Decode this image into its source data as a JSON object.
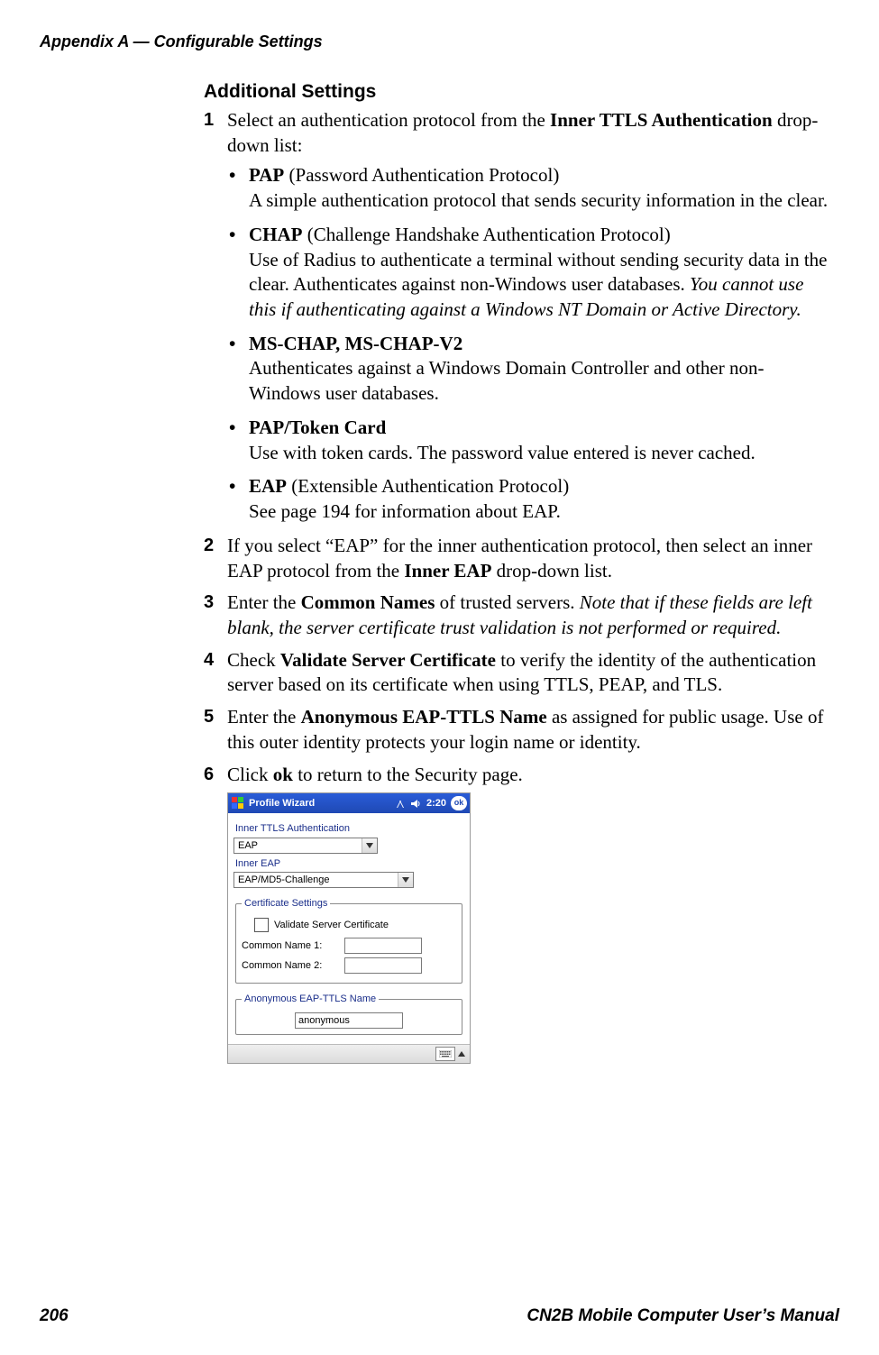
{
  "runningHeader": "Appendix A — Configurable Settings",
  "sectionTitle": "Additional Settings",
  "steps": {
    "s1_a": "Select an authentication protocol from the ",
    "s1_b": "Inner TTLS Authentication",
    "s1_c": " drop-down list:",
    "s2_a": "If you select “EAP” for the inner authentication protocol, then select an inner EAP protocol from the ",
    "s2_b": "Inner EAP",
    "s2_c": " drop-down list.",
    "s3_a": "Enter the ",
    "s3_b": "Common Names",
    "s3_c": " of trusted servers. ",
    "s3_d": "Note that if these fields are left blank, the server certificate trust validation is not performed or required.",
    "s4_a": "Check ",
    "s4_b": "Validate Server Certificate",
    "s4_c": " to verify the identity of the authentication server based on its certificate when using TTLS, PEAP, and TLS.",
    "s5_a": "Enter the ",
    "s5_b": "Anonymous EAP-TTLS Name",
    "s5_c": " as assigned for public usage. Use of this outer identity protects your login name or identity.",
    "s6_a": "Click ",
    "s6_b": "ok",
    "s6_c": " to return to the Security page."
  },
  "bullets": {
    "pap_title": "PAP",
    "pap_paren": " (Password Authentication Protocol)",
    "pap_body": "A simple authentication protocol that sends security information in the clear.",
    "chap_title": "CHAP",
    "chap_paren": " (Challenge Handshake Authentication Protocol)",
    "chap_body_a": "Use of Radius to authenticate a terminal without sending security data in the clear. Authenticates against non-Windows user databases. ",
    "chap_body_b": "You cannot use this if authenticating against a Windows NT Domain or Active Directory.",
    "mschap_title": "MS-CHAP, MS-CHAP-V2",
    "mschap_body": "Authenticates against a Windows Domain Controller and other non-Windows user databases.",
    "paptoken_title": "PAP/Token Card",
    "paptoken_body": "Use with token cards. The password value entered is never cached.",
    "eap_title": "EAP",
    "eap_paren": " (Extensible Authentication Protocol)",
    "eap_body": "See page 194 for information about EAP."
  },
  "shot": {
    "title": "Profile Wizard",
    "time": "2:20",
    "ok": "ok",
    "lbl_inner_ttls": "Inner TTLS Authentication",
    "combo_inner_ttls": "EAP",
    "lbl_inner_eap": "Inner EAP",
    "combo_inner_eap": "EAP/MD5-Challenge",
    "grp_cert": "Certificate Settings",
    "cb_validate": "Validate Server Certificate",
    "lbl_cn1": "Common Name 1:",
    "lbl_cn2": "Common Name 2:",
    "val_cn1": "",
    "val_cn2": "",
    "grp_anon": "Anonymous EAP-TTLS Name",
    "val_anon": "anonymous"
  },
  "footer": {
    "pageNum": "206",
    "bookTitle": "CN2B Mobile Computer User’s Manual"
  }
}
